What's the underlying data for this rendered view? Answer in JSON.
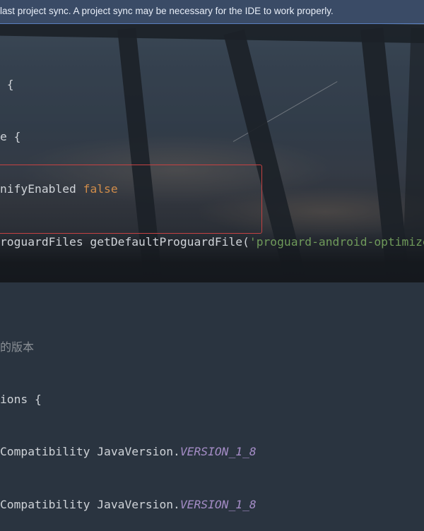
{
  "notification": {
    "text": "last project sync. A project sync may be necessary for the IDE to work properly."
  },
  "code": {
    "lines": [
      {
        "plain": " {"
      },
      {
        "plain": "e {"
      },
      {
        "plain": "nifyEnabled ",
        "keyword": "false"
      },
      {
        "plain": "roguardFiles getDefaultProguardFile(",
        "string": "'proguard-android-optimize."
      },
      {
        "plain": ""
      },
      {
        "comment": "的版本"
      },
      {
        "plain": "ions {"
      },
      {
        "plain": "Compatibility JavaVersion.",
        "constant": "VERSION_1_8"
      },
      {
        "plain": "Compatibility JavaVersion.",
        "constant": "VERSION_1_8"
      }
    ]
  }
}
